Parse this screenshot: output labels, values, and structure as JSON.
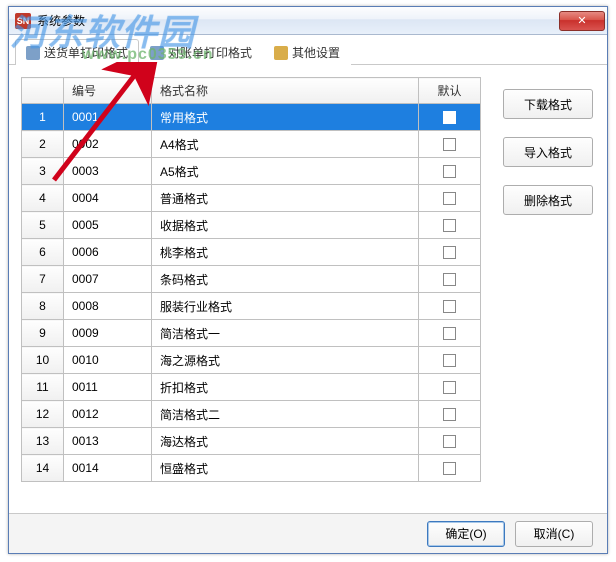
{
  "window": {
    "title": "系统参数"
  },
  "tabs": [
    {
      "label": "送货单打印格式"
    },
    {
      "label": "对账单打印格式"
    },
    {
      "label": "其他设置"
    }
  ],
  "table": {
    "headers": {
      "num": "",
      "code": "编号",
      "name": "格式名称",
      "def": "默认"
    },
    "rows": [
      {
        "n": "1",
        "code": "0001",
        "name": "常用格式",
        "selected": true
      },
      {
        "n": "2",
        "code": "0002",
        "name": "A4格式",
        "selected": false
      },
      {
        "n": "3",
        "code": "0003",
        "name": "A5格式",
        "selected": false
      },
      {
        "n": "4",
        "code": "0004",
        "name": "普通格式",
        "selected": false
      },
      {
        "n": "5",
        "code": "0005",
        "name": "收据格式",
        "selected": false
      },
      {
        "n": "6",
        "code": "0006",
        "name": "桃李格式",
        "selected": false
      },
      {
        "n": "7",
        "code": "0007",
        "name": "条码格式",
        "selected": false
      },
      {
        "n": "8",
        "code": "0008",
        "name": "服装行业格式",
        "selected": false
      },
      {
        "n": "9",
        "code": "0009",
        "name": "简洁格式一",
        "selected": false
      },
      {
        "n": "10",
        "code": "0010",
        "name": "海之源格式",
        "selected": false
      },
      {
        "n": "11",
        "code": "0011",
        "name": "折扣格式",
        "selected": false
      },
      {
        "n": "12",
        "code": "0012",
        "name": "简洁格式二",
        "selected": false
      },
      {
        "n": "13",
        "code": "0013",
        "name": "海达格式",
        "selected": false
      },
      {
        "n": "14",
        "code": "0014",
        "name": "恒盛格式",
        "selected": false
      }
    ]
  },
  "sidebar": {
    "download": "下载格式",
    "import": "导入格式",
    "delete": "删除格式"
  },
  "footer": {
    "ok": "确定(O)",
    "cancel": "取消(C)"
  },
  "watermark": {
    "text": "河东软件园",
    "url": "www.pc0359.cn"
  }
}
